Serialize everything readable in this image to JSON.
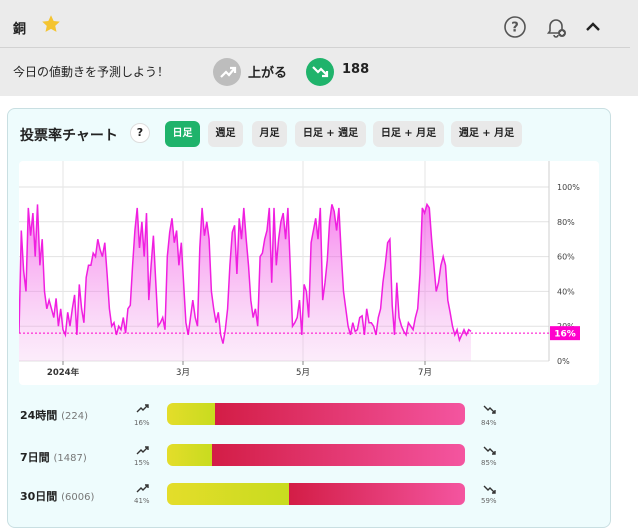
{
  "header": {
    "title": "銅"
  },
  "predict": {
    "prompt": "今日の値動きを予測しよう！",
    "up_label": "上がる",
    "down_count": "188"
  },
  "chart_card": {
    "title": "投票率チャート",
    "help": "?",
    "tabs": [
      "日足",
      "週足",
      "月足",
      "日足 + 週足",
      "日足 + 月足",
      "週足 + 月足"
    ],
    "active_tab": 0
  },
  "chart_data": {
    "type": "area",
    "x_tick_labels": [
      "2024年",
      "3月",
      "5月",
      "7月"
    ],
    "y_ticks": [
      "100%",
      "80%",
      "60%",
      "40%",
      "20%",
      "0%"
    ],
    "ylim": [
      0,
      100
    ],
    "current_value_label": "16%",
    "current_value": 16,
    "colors": {
      "line": "#f01fe0",
      "fill": "#f2b3ec",
      "marker": "#ff00cc"
    },
    "values": [
      16,
      75,
      52,
      40,
      88,
      72,
      85,
      60,
      90,
      55,
      70,
      40,
      30,
      35,
      30,
      25,
      36,
      20,
      30,
      18,
      15,
      28,
      20,
      30,
      38,
      15,
      44,
      30,
      22,
      48,
      55,
      55,
      62,
      60,
      70,
      64,
      60,
      68,
      50,
      30,
      20,
      22,
      15,
      20,
      18,
      25,
      16,
      30,
      32,
      55,
      75,
      88,
      65,
      80,
      60,
      85,
      35,
      55,
      72,
      45,
      20,
      22,
      25,
      18,
      60,
      74,
      82,
      68,
      75,
      55,
      68,
      45,
      22,
      15,
      25,
      35,
      25,
      20,
      65,
      88,
      72,
      80,
      70,
      40,
      30,
      22,
      28,
      15,
      10,
      18,
      30,
      55,
      74,
      78,
      50,
      82,
      70,
      88,
      70,
      55,
      35,
      25,
      30,
      20,
      60,
      62,
      70,
      75,
      88,
      45,
      88,
      55,
      70,
      80,
      85,
      70,
      88,
      55,
      20,
      22,
      25,
      35,
      15,
      44,
      40,
      25,
      68,
      75,
      82,
      70,
      88,
      35,
      45,
      58,
      80,
      90,
      86,
      75,
      88,
      62,
      40,
      30,
      20,
      15,
      22,
      17,
      18,
      25,
      26,
      15,
      30,
      22,
      22,
      20,
      15,
      25,
      30,
      45,
      55,
      68,
      70,
      32,
      15,
      45,
      25,
      20,
      17,
      15,
      22,
      20,
      18,
      25,
      30,
      50,
      88,
      85,
      90,
      88,
      70,
      55,
      40,
      45,
      55,
      60,
      55,
      35,
      28,
      20,
      15,
      18,
      12,
      15,
      18,
      15,
      18,
      17
    ]
  },
  "stats": [
    {
      "label": "24時間",
      "count": "(224)",
      "up_pct": "16%",
      "down_pct": "84%",
      "up_value": 16
    },
    {
      "label": "7日間",
      "count": "(1487)",
      "up_pct": "15%",
      "down_pct": "85%",
      "up_value": 15
    },
    {
      "label": "30日間",
      "count": "(6006)",
      "up_pct": "41%",
      "down_pct": "59%",
      "up_value": 41
    }
  ]
}
